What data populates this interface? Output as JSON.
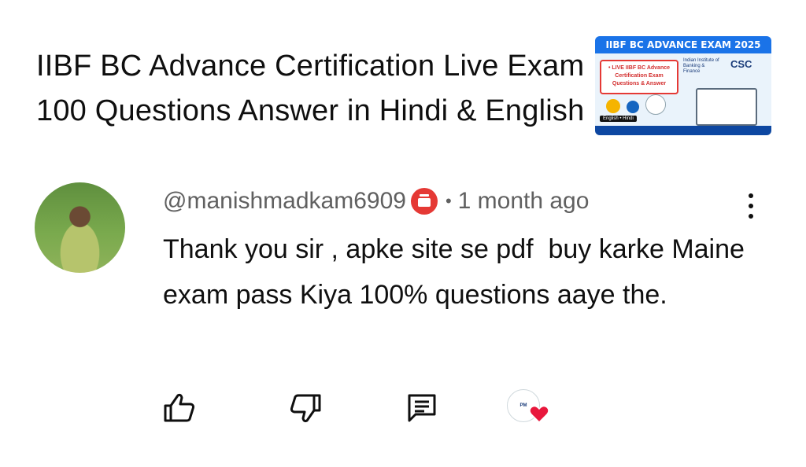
{
  "video": {
    "title": "IIBF BC Advance Certification Live Exam 100 Questions Answer in Hindi & English",
    "thumbnail": {
      "banner": "IIBF BC ADVANCE EXAM 2025",
      "red_box": "• LIVE IIBF BC Advance Certification Exam Questions & Answer",
      "org": "Indian Institute of Banking & Finance",
      "csc": "CSC",
      "language": "English • Hindi"
    }
  },
  "comment": {
    "author": "@manishmadkam6909",
    "badge_icon": "member-badge-icon",
    "separator": "•",
    "time": "1 month ago",
    "text": "Thank you sir , apke site se pdf  buy karke Maine exam pass Kiya 100% questions aaye the.",
    "more_icon": "more-vert-icon"
  },
  "actions": {
    "like_icon": "thumbs-up-icon",
    "dislike_icon": "thumbs-down-icon",
    "reply_icon": "comment-icon",
    "creator_heart_icon": "creator-heart-icon"
  },
  "colors": {
    "badge": "#e53935",
    "heart": "#e8173c",
    "thumb_banner": "#1a73e8"
  }
}
